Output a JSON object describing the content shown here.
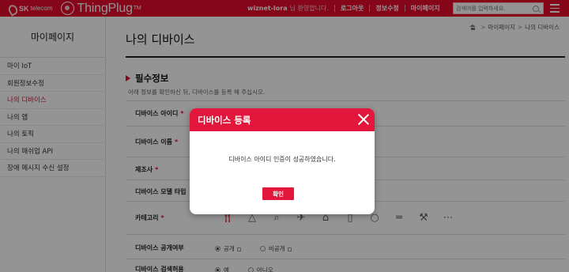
{
  "header": {
    "brand_sk_bold": "SK",
    "brand_sk": "telecom",
    "brand_app": "ThingPlug",
    "brand_tm": "TM",
    "username": "wiznet-lora",
    "greeting": "님 환영합니다.",
    "links": [
      "로그아웃",
      "정보수정",
      "마이페이지"
    ],
    "search_placeholder": "검색어를 입력하세요."
  },
  "sidebar": {
    "title": "마이페이지",
    "items": [
      {
        "label": "마이 IoT",
        "active": false
      },
      {
        "label": "회원정보수정",
        "active": false
      },
      {
        "label": "나의 디바이스",
        "active": true
      },
      {
        "label": "나의 앱",
        "active": false
      },
      {
        "label": "나의 토픽",
        "active": false
      },
      {
        "label": "나의 매쉬업 API",
        "active": false
      },
      {
        "label": "장애 메시지 수신 설정",
        "active": false
      }
    ]
  },
  "main": {
    "breadcrumb": [
      "마이페이지",
      "나의 디바이스"
    ],
    "title": "나의 디바이스",
    "section_title": "필수정보",
    "section_desc": "아래 정보를 확인하신 뒤, 디바이스를 등록 해 주십시오.",
    "fields": [
      {
        "label": "디바이스 아이디",
        "required": true
      },
      {
        "label": "디바이스 이름",
        "required": true
      },
      {
        "label": "제조사",
        "required": true
      },
      {
        "label": "디바이스 모델 타입",
        "required": false
      },
      {
        "label": "카테고리",
        "required": true
      },
      {
        "label": "디바이스 공개여부",
        "required": false
      },
      {
        "label": "디바이스 검색허용",
        "required": false
      }
    ],
    "required_mark": "*",
    "category_icons": [
      "fork-knife-icon",
      "graduation-cap-icon",
      "magnifier-icon",
      "airplane-icon",
      "house-icon",
      "smartphone-icon",
      "lightbulb-icon",
      "dumbbell-icon",
      "tools-icon",
      "more-icon"
    ],
    "public_options": [
      "공개",
      "비공개"
    ],
    "search_options": [
      "예",
      "아니오"
    ]
  },
  "modal": {
    "title": "디바이스 등록",
    "message": "디바이스 아이디 인증이 성공하였습니다.",
    "confirm_label": "확인"
  },
  "colors": {
    "brand_red": "#e60a2b",
    "modal_red": "#e2173b"
  }
}
